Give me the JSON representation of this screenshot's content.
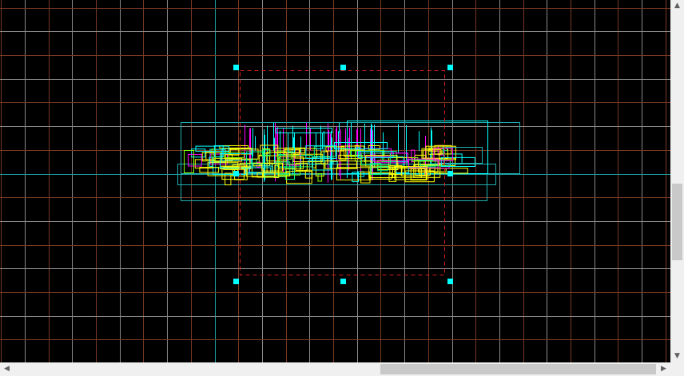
{
  "canvas": {
    "background": "#000000",
    "grid_minor_color": "#7a3a22",
    "grid_major_color": "#8a8a8a",
    "axis_color": "#1aa0a0",
    "selection_color": "#d42020",
    "handle_color": "#00ffff"
  },
  "model": {
    "palette": [
      "#ffff00",
      "#00ffff",
      "#ff00ff",
      "#00ff80",
      "#80ff00",
      "#20b0b0"
    ]
  },
  "scrollbars": {
    "up_icon": "▲",
    "down_icon": "▼",
    "left_icon": "◀",
    "right_icon": "▶"
  }
}
